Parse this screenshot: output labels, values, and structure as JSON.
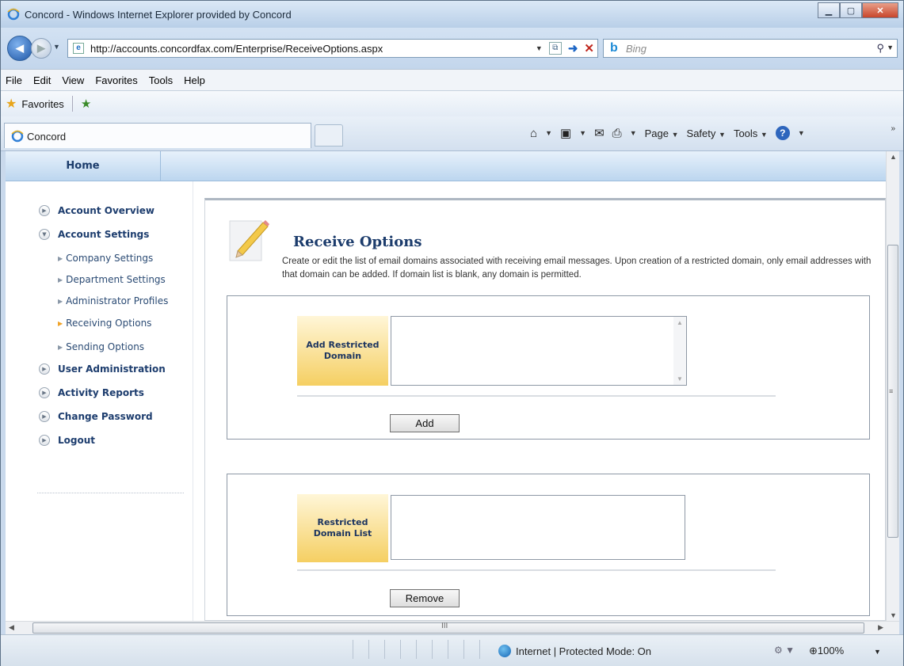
{
  "window": {
    "title": "Concord - Windows Internet Explorer provided by Concord"
  },
  "address_bar": {
    "url": "http://accounts.concordfax.com/Enterprise/ReceiveOptions.aspx"
  },
  "search": {
    "placeholder": "Bing"
  },
  "menu": [
    "File",
    "Edit",
    "View",
    "Favorites",
    "Tools",
    "Help"
  ],
  "favorites_bar": {
    "label": "Favorites"
  },
  "tab": {
    "label": "Concord"
  },
  "command_bar": {
    "page": "Page",
    "safety": "Safety",
    "tools": "Tools"
  },
  "status_bar": {
    "zone": "Internet | Protected Mode: On",
    "zoom": "100%"
  },
  "site": {
    "home_tab": "Home",
    "nav": {
      "account_overview": "Account Overview",
      "account_settings": "Account Settings",
      "sub": [
        "Company Settings",
        "Department Settings",
        "Administrator Profiles",
        "Receiving Options",
        "Sending Options"
      ],
      "user_administration": "User Administration",
      "activity_reports": "Activity Reports",
      "change_password": "Change Password",
      "logout": "Logout"
    },
    "page_title": "Receive Options",
    "description": "Create or edit the list of email domains associated with receiving email messages. Upon creation of a restricted domain, only email addresses with that domain can be added. If domain list is blank, any domain is permitted.",
    "add_panel": {
      "label": "Add Restricted Domain",
      "value": "",
      "button": "Add"
    },
    "list_panel": {
      "label": "Restricted Domain List",
      "items": [],
      "button": "Remove"
    }
  }
}
